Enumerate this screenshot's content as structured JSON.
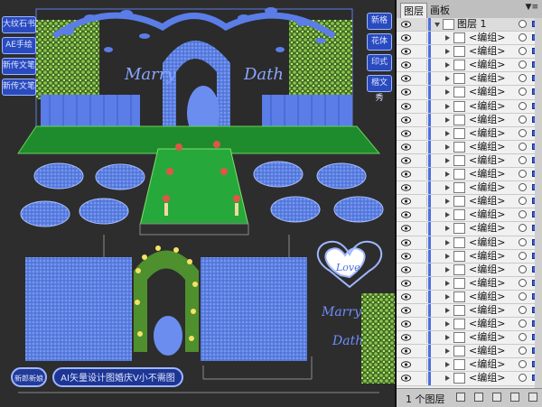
{
  "canvas": {
    "left_labels": [
      "大纹石书",
      "AE手绘",
      "新传文笔",
      "新传文笔"
    ],
    "right_labels": [
      "新格",
      "花体",
      "印式",
      "楷文秀"
    ],
    "script_left": "Marry",
    "script_right": "Dath",
    "heart_text": "Love",
    "lower_script_1": "Marry",
    "lower_script_2": "Dath",
    "footer_badge": "新郎新娘",
    "footer_caption": "AI矢量设计图婚庆V小不需图"
  },
  "panel": {
    "tabs": [
      "图层",
      "画板"
    ],
    "menu_icon": "menu-icon",
    "top_layer": "图层 1",
    "rows": [
      "<编组>",
      "<编组>",
      "<编组>",
      "<编组>",
      "<编组>",
      "<编组>",
      "<编组>",
      "<编组>",
      "<编组>",
      "<编组>",
      "<编组>",
      "<编组>",
      "<编组>",
      "<编组>",
      "<编组>",
      "<编组>",
      "<编组>",
      "<编组>",
      "<编组>",
      "<编组>",
      "<编组>",
      "<编组>",
      "<编组>",
      "<编组>",
      "<编组>",
      "<编组>"
    ],
    "footer_count": "1 个图层"
  }
}
